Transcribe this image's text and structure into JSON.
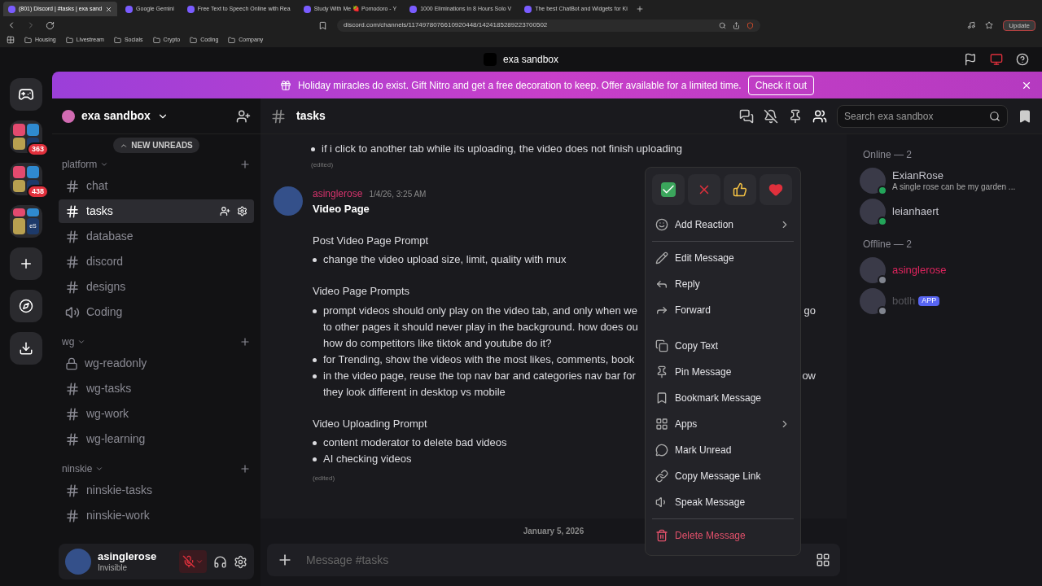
{
  "browser": {
    "tabs": [
      {
        "title": "(801) Discord | #tasks | exa sand",
        "selected": true
      },
      {
        "title": "Google Gemini",
        "selected": false
      },
      {
        "title": "Free Text to Speech Online with Rea",
        "selected": false
      },
      {
        "title": "Study With Me 🍓 Pomodoro - Y",
        "selected": false
      },
      {
        "title": "1000 Eliminations In 8 Hours Solo V",
        "selected": false
      },
      {
        "title": "The best ChatBot and Widgets for Ki",
        "selected": false
      }
    ],
    "url": "discord.com/channels/1174978076610920448/1424185289223700502",
    "update": "Update",
    "bookmarks": [
      "Housing",
      "Livestream",
      "Socials",
      "Crypto",
      "Coding",
      "Company"
    ]
  },
  "app_title": "exa sandbox",
  "banner": {
    "text": "Holiday miracles do exist. Gift Nitro and get a free decoration to keep. Offer available for a limited time.",
    "button": "Check it out"
  },
  "servers": [
    {
      "kind": "home"
    },
    {
      "kind": "folder",
      "badge": "363"
    },
    {
      "kind": "folder",
      "badge": "438"
    },
    {
      "kind": "folder",
      "label": "eS"
    },
    {
      "kind": "add"
    },
    {
      "kind": "discover"
    },
    {
      "kind": "download"
    }
  ],
  "sidebar": {
    "server": "exa sandbox",
    "new_unreads": "NEW UNREADS",
    "categories": [
      {
        "name": "platform",
        "channels": [
          {
            "name": "chat",
            "kind": "text",
            "selected": false
          },
          {
            "name": "tasks",
            "kind": "text",
            "selected": true
          },
          {
            "name": "database",
            "kind": "text",
            "selected": false
          },
          {
            "name": "discord",
            "kind": "text",
            "selected": false
          },
          {
            "name": "designs",
            "kind": "text",
            "selected": false
          },
          {
            "name": "Coding",
            "kind": "voice",
            "selected": false
          }
        ]
      },
      {
        "name": "wg",
        "channels": [
          {
            "name": "wg-readonly",
            "kind": "locked",
            "selected": false
          },
          {
            "name": "wg-tasks",
            "kind": "text",
            "selected": false
          },
          {
            "name": "wg-work",
            "kind": "text",
            "selected": false
          },
          {
            "name": "wg-learning",
            "kind": "text",
            "selected": false
          }
        ]
      },
      {
        "name": "ninskie",
        "channels": [
          {
            "name": "ninskie-tasks",
            "kind": "text",
            "selected": false
          },
          {
            "name": "ninskie-work",
            "kind": "text",
            "selected": false
          }
        ]
      }
    ]
  },
  "user": {
    "name": "asinglerose",
    "status": "Invisible",
    "muted": true
  },
  "channel": {
    "name": "tasks",
    "search_placeholder": "Search exa sandbox"
  },
  "message_tail": {
    "bullets": [
      {
        "lines": [
          {
            "left": "if i click to another tab while its uploading, the video does not finish uploading"
          }
        ]
      }
    ],
    "edited": "(edited)"
  },
  "message": {
    "author": "asinglerose",
    "time": "1/4/26, 3:25 AM",
    "title": "Video Page",
    "sections": [
      {
        "heading": "Post Video Page Prompt",
        "bullets": [
          {
            "lines": [
              {
                "left": "change the video upload size, limit, quality with mux"
              }
            ]
          }
        ]
      },
      {
        "heading": "Video Page Prompts",
        "bullets": [
          {
            "lines": [
              {
                "left": "prompt videos should only play on the video tab, and only when we",
                "right": "go"
              },
              {
                "left": "to other pages it should never play in the background. how does ou"
              },
              {
                "left": "how do competitors like tiktok and youtube do it?"
              }
            ]
          },
          {
            "lines": [
              {
                "left": "for Trending, show the videos with the most likes, comments, book"
              }
            ]
          },
          {
            "lines": [
              {
                "left": "in the video page, reuse the top nav bar and categories nav bar for",
                "right": "ow"
              },
              {
                "left": "they look different in desktop vs mobile"
              }
            ]
          }
        ]
      },
      {
        "heading": "Video Uploading Prompt",
        "bullets": [
          {
            "lines": [
              {
                "left": "content moderator to delete bad videos"
              }
            ]
          },
          {
            "lines": [
              {
                "left": "AI checking videos"
              }
            ]
          }
        ]
      }
    ],
    "edited": "(edited)"
  },
  "date_divider": "January 5, 2026",
  "composer": {
    "placeholder": "Message #tasks"
  },
  "menu": {
    "groups": [
      {
        "divider_before": false,
        "items": [
          {
            "label": "Add Reaction",
            "kind": "normal",
            "submenu": true
          }
        ]
      },
      {
        "divider_before": true,
        "items": [
          {
            "label": "Edit Message",
            "kind": "normal",
            "submenu": false
          },
          {
            "label": "Reply",
            "kind": "normal",
            "submenu": false
          },
          {
            "label": "Forward",
            "kind": "normal",
            "submenu": false
          }
        ]
      },
      {
        "divider_before": false,
        "items": [
          {
            "label": "Copy Text",
            "kind": "normal",
            "submenu": false
          },
          {
            "label": "Pin Message",
            "kind": "normal",
            "submenu": false
          },
          {
            "label": "Bookmark Message",
            "kind": "normal",
            "submenu": false
          },
          {
            "label": "Apps",
            "kind": "normal",
            "submenu": true
          },
          {
            "label": "Mark Unread",
            "kind": "normal",
            "submenu": false
          },
          {
            "label": "Copy Message Link",
            "kind": "normal",
            "submenu": false
          },
          {
            "label": "Speak Message",
            "kind": "normal",
            "submenu": false
          }
        ]
      },
      {
        "divider_before": true,
        "items": [
          {
            "label": "Delete Message",
            "kind": "danger",
            "submenu": false
          }
        ]
      }
    ]
  },
  "members": {
    "sections": [
      {
        "heading": "Online — 2",
        "members": [
          {
            "name": "ExianRose",
            "activity": "A single rose can be my garden ...",
            "online": true,
            "color": "#c4c4cc"
          },
          {
            "name": "leianhaert",
            "online": true,
            "color": "#c4c4cc"
          }
        ]
      },
      {
        "heading": "Offline — 2",
        "members": [
          {
            "name": "asinglerose",
            "online": false,
            "color": "#e0245e"
          },
          {
            "name": "botlh",
            "badge": "APP",
            "online": false,
            "color": "#56565c"
          }
        ]
      }
    ]
  }
}
